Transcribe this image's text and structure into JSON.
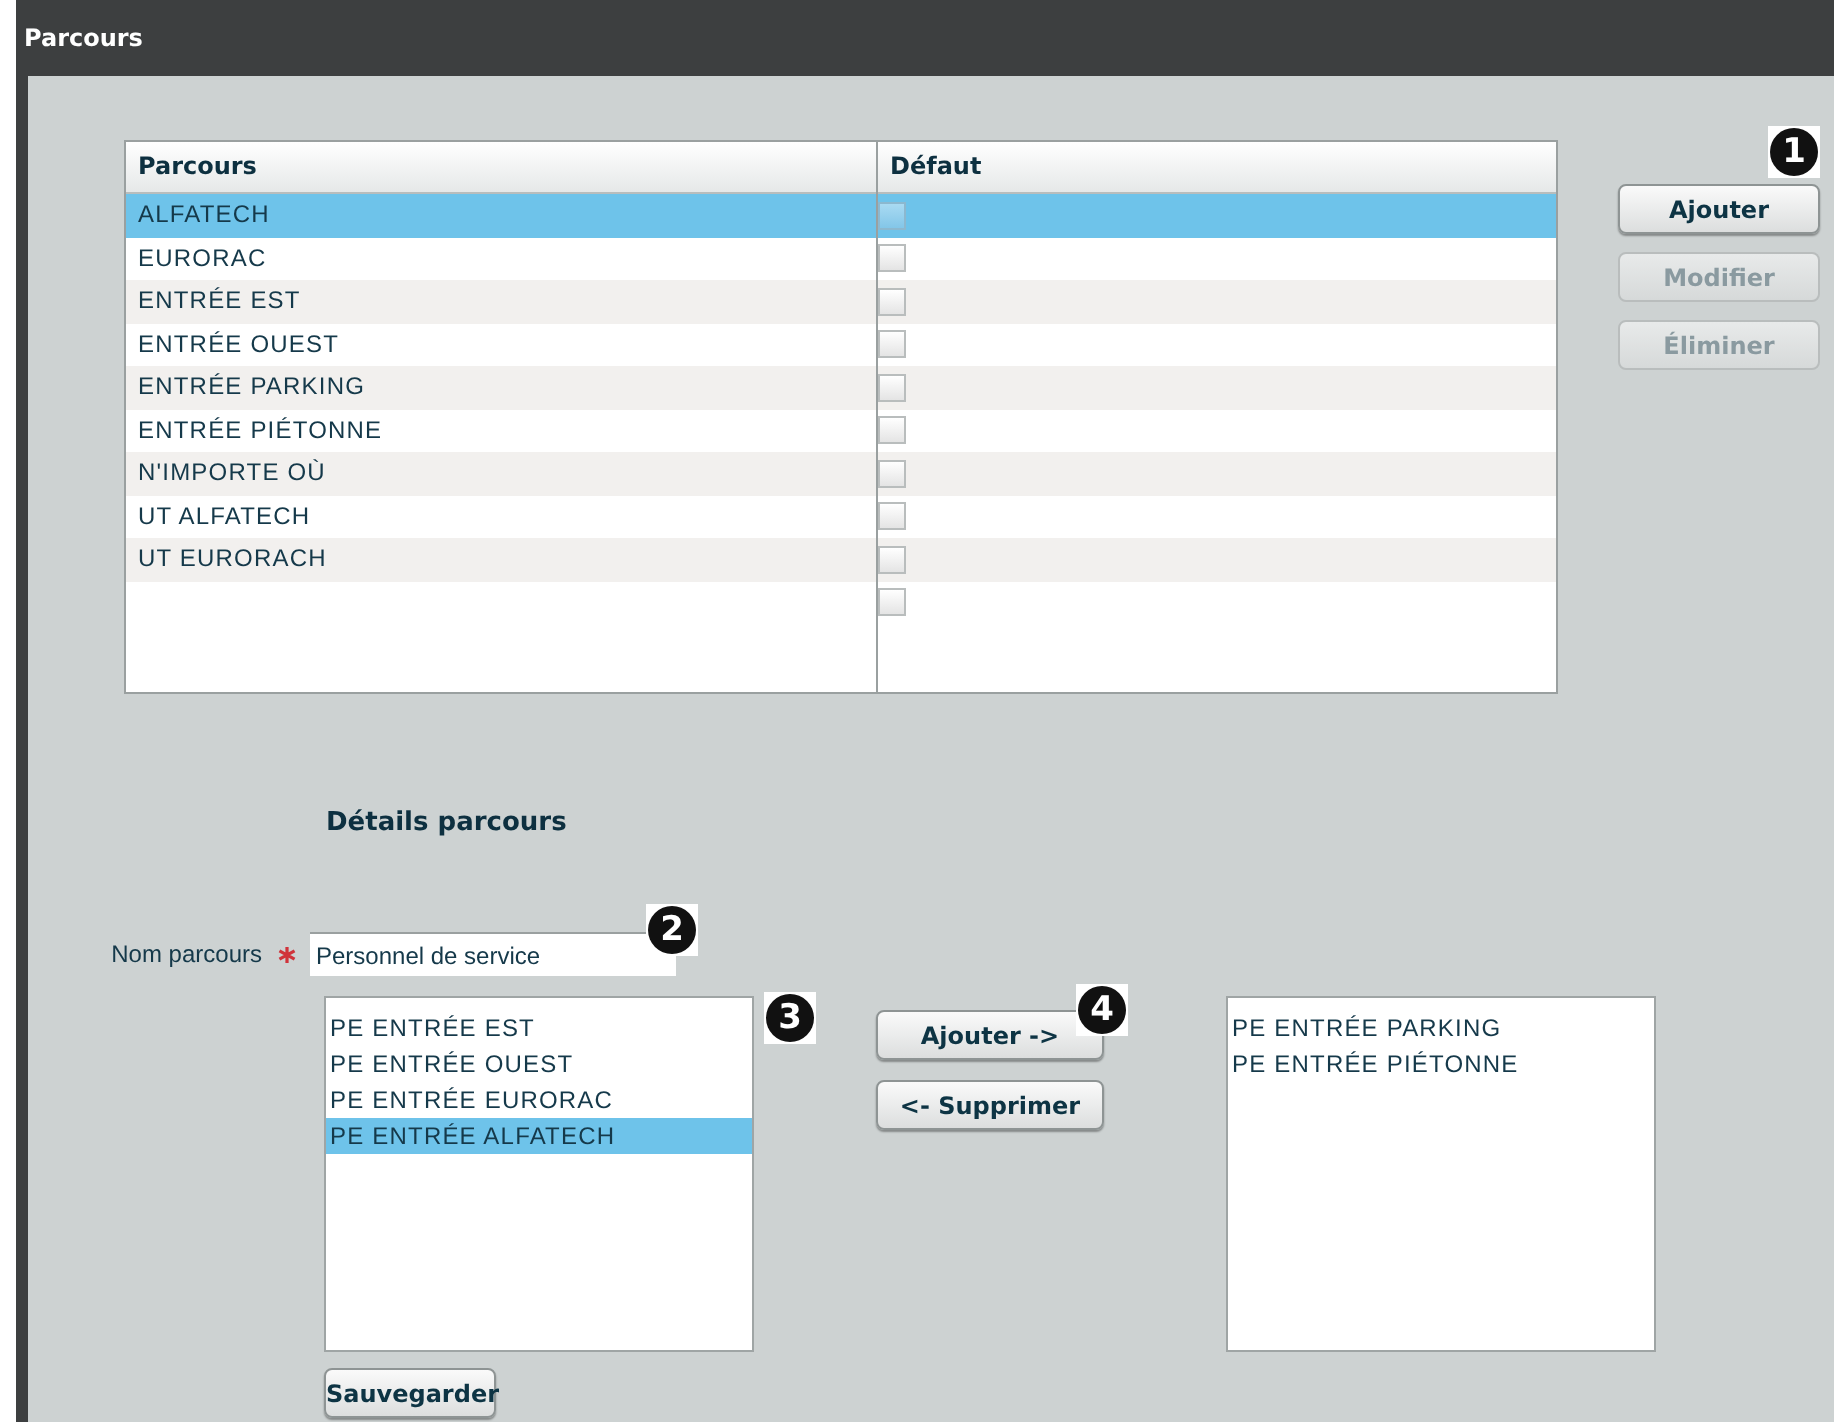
{
  "window": {
    "title": "Parcours"
  },
  "table": {
    "columns": [
      "Parcours",
      "Défaut"
    ],
    "rows": [
      {
        "name": "ALFATECH",
        "default": false,
        "selected": true
      },
      {
        "name": "EURORAC",
        "default": false,
        "selected": false
      },
      {
        "name": "ENTRÉE EST",
        "default": false,
        "selected": false
      },
      {
        "name": "ENTRÉE OUEST",
        "default": false,
        "selected": false
      },
      {
        "name": "ENTRÉE PARKING",
        "default": false,
        "selected": false
      },
      {
        "name": "ENTRÉE PIÉTONNE",
        "default": false,
        "selected": false
      },
      {
        "name": "N'IMPORTE OÙ",
        "default": false,
        "selected": false
      },
      {
        "name": "UT ALFATECH",
        "default": false,
        "selected": false
      },
      {
        "name": "UT EURORACH",
        "default": false,
        "selected": false
      },
      {
        "default": false,
        "selected": false
      }
    ]
  },
  "table_buttons": [
    {
      "label": "Ajouter",
      "disabled": false,
      "callout": "1"
    },
    {
      "label": "Modifier",
      "disabled": true
    },
    {
      "label": "Éliminer",
      "disabled": true
    }
  ],
  "details": {
    "title": "Détails parcours",
    "name_field": {
      "label": "Nom parcours",
      "required": true,
      "value": "Personnel de service",
      "callout": "2"
    },
    "available": {
      "callout": "3",
      "items": [
        {
          "label": "PE ENTRÉE EST",
          "selected": false
        },
        {
          "label": "PE ENTRÉE OUEST",
          "selected": false
        },
        {
          "label": "PE ENTRÉE EURORAC",
          "selected": false
        },
        {
          "label": "PE ENTRÉE ALFATECH",
          "selected": true
        }
      ]
    },
    "move_buttons": [
      {
        "label": "Ajouter ->",
        "callout": "4"
      },
      {
        "label": "<- Supprimer"
      }
    ],
    "chosen": {
      "items": [
        {
          "label": "PE ENTRÉE PARKING",
          "selected": false
        },
        {
          "label": "PE ENTRÉE PIÉTONNE",
          "selected": false
        }
      ]
    },
    "save_button": {
      "label": "Sauvegarder"
    }
  }
}
